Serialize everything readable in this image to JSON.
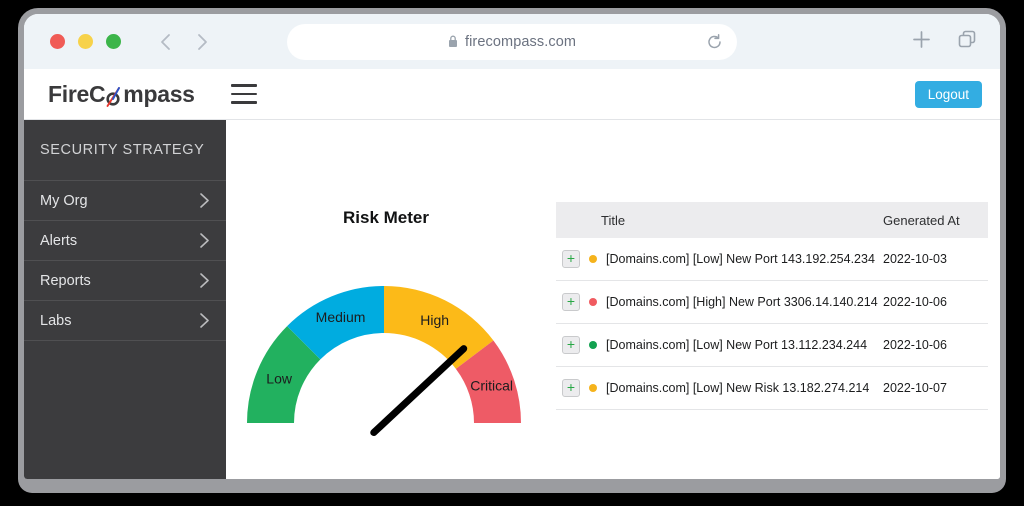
{
  "browser": {
    "traffic_lights": [
      "close",
      "minimize",
      "maximize"
    ],
    "back_label": "Back",
    "forward_label": "Forward",
    "url": "firecompass.com",
    "lock_icon": "lock-icon",
    "reload_icon": "reload-icon",
    "new_tab_icon": "plus-icon",
    "tabs_icon": "copy-tabs-icon"
  },
  "header": {
    "brand_prefix": "FireC",
    "brand_suffix": "mpass",
    "menu_icon": "hamburger-icon",
    "logout_label": "Logout",
    "logout_color": "#33ade2"
  },
  "sidebar": {
    "title": "SECURITY STRATEGY",
    "items": [
      {
        "label": "My Org",
        "icon": "chevron-right-icon"
      },
      {
        "label": "Alerts",
        "icon": "chevron-right-icon"
      },
      {
        "label": "Reports",
        "icon": "chevron-right-icon"
      },
      {
        "label": "Labs",
        "icon": "chevron-right-icon"
      }
    ]
  },
  "chart_data": {
    "type": "gauge",
    "title": "Risk Meter",
    "categories": [
      "Low",
      "Medium",
      "High",
      "Critical"
    ],
    "colors": [
      "#22b15f",
      "#00ace0",
      "#fcba18",
      "#ee5b66"
    ],
    "segments": [
      {
        "label": "Low",
        "color": "#22b15f",
        "start_angle": 180,
        "end_angle": 135
      },
      {
        "label": "Medium",
        "color": "#00ace0",
        "start_angle": 135,
        "end_angle": 90
      },
      {
        "label": "High",
        "color": "#fcba18",
        "start_angle": 90,
        "end_angle": 37
      },
      {
        "label": "Critical",
        "color": "#ee5b66",
        "start_angle": 37,
        "end_angle": 0
      }
    ],
    "needle_angle": 43,
    "needle_value_label": "High",
    "needle_color": "#000000",
    "ylim": [
      0,
      180
    ],
    "grid": false,
    "legend": "none"
  },
  "table": {
    "columns": [
      "Title",
      "Generated At"
    ],
    "rows": [
      {
        "expand": "+",
        "severity_color": "#f5b31c",
        "title": "[Domains.com] [Low] New Port 143.192.254.234",
        "generated_at": "2022-10-03"
      },
      {
        "expand": "+",
        "severity_color": "#f05b60",
        "title": "[Domains.com] [High] New Port 3306.14.140.214",
        "generated_at": "2022-10-06"
      },
      {
        "expand": "+",
        "severity_color": "#12a150",
        "title": "[Domains.com] [Low] New Port 13.112.234.244",
        "generated_at": "2022-10-06"
      },
      {
        "expand": "+",
        "severity_color": "#f5b31c",
        "title": "[Domains.com] [Low] New Risk 13.182.274.214",
        "generated_at": "2022-10-07"
      }
    ]
  }
}
